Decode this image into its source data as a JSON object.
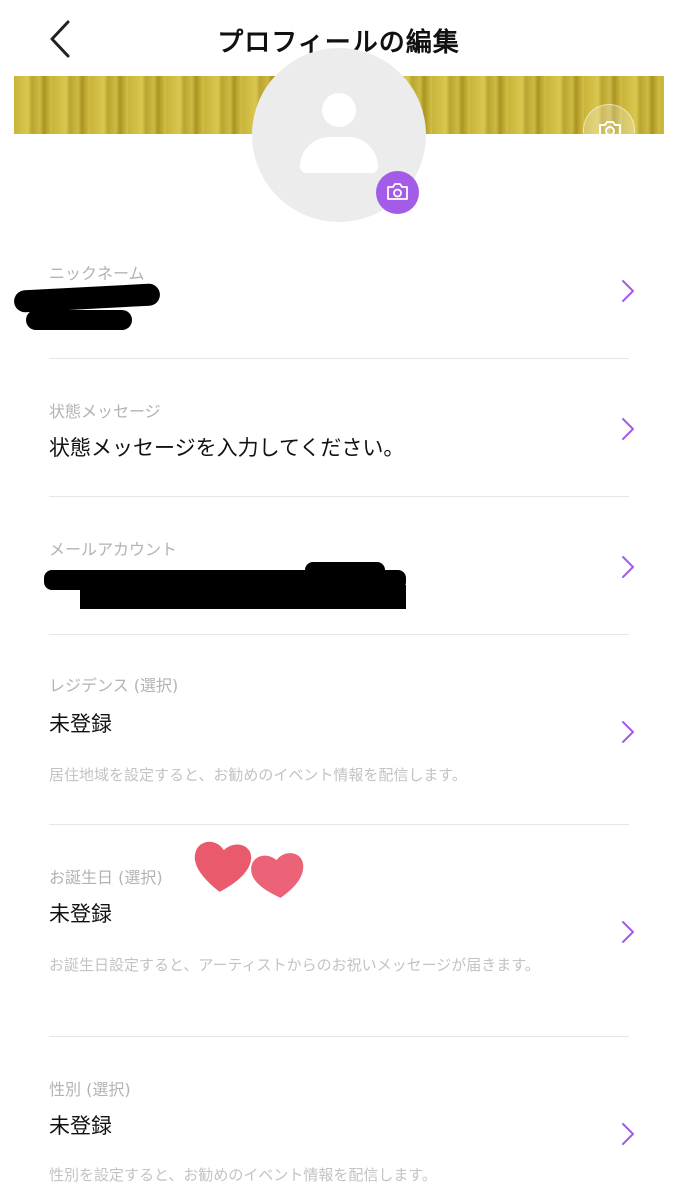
{
  "header": {
    "title": "プロフィールの編集",
    "back_icon": "chevron-left-icon"
  },
  "profile": {
    "cover_camera_icon": "camera-icon",
    "avatar_icon": "person-placeholder-icon",
    "avatar_camera_icon": "camera-icon",
    "accent_color": "#a35be8"
  },
  "fields": {
    "nickname": {
      "label": "ニックネーム",
      "value": ""
    },
    "status": {
      "label": "状態メッセージ",
      "value": "状態メッセージを入力してください。"
    },
    "email": {
      "label": "メールアカウント",
      "value": ""
    },
    "residence": {
      "label": "レジデンス (選択)",
      "value": "未登録",
      "note": "居住地域を設定すると、お勧めのイベント情報を配信します。"
    },
    "birthday": {
      "label": "お誕生日 (選択)",
      "value": "未登録",
      "note": "お誕生日設定すると、アーティストからのお祝いメッセージが届きます。"
    },
    "gender": {
      "label": "性別 (選択)",
      "value": "未登録",
      "note": "性別を設定すると、お勧めのイベント情報を配信します。"
    }
  },
  "decorations": {
    "sticker": "hearts-sticker",
    "sticker_color": "#e95a6d"
  }
}
